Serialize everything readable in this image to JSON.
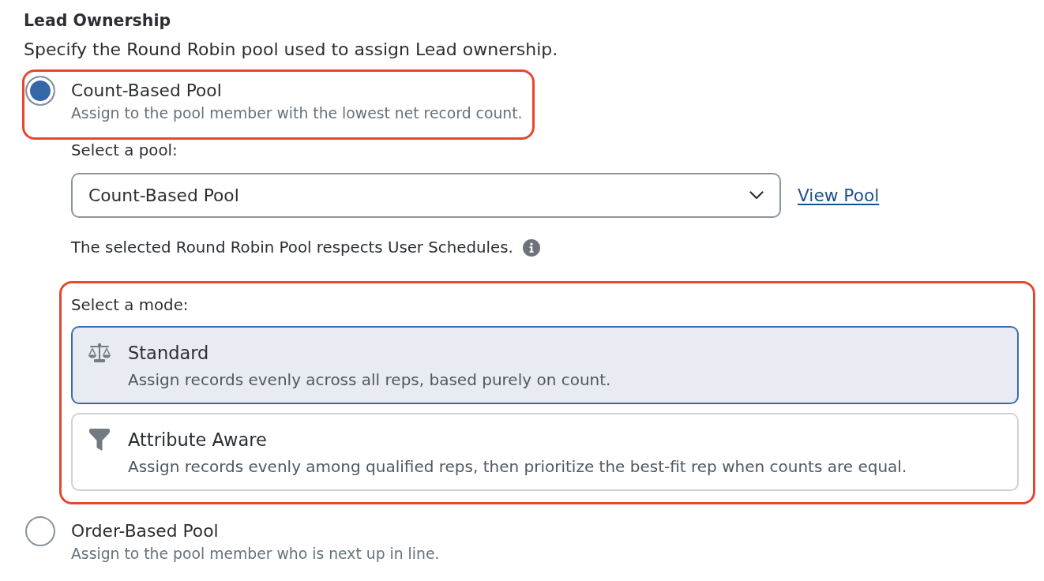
{
  "section": {
    "title": "Lead Ownership",
    "description": "Specify the Round Robin pool used to assign Lead ownership."
  },
  "pool_options": [
    {
      "label": "Count-Based Pool",
      "description": "Assign to the pool member with the lowest net record count.",
      "selected": true,
      "highlighted": true,
      "pool_picker": {
        "label": "Select a pool:",
        "value": "Count-Based Pool",
        "link": "View Pool"
      },
      "note": "The selected Round Robin Pool respects User Schedules.",
      "modes": {
        "label": "Select a mode:",
        "highlighted": true,
        "options": [
          {
            "title": "Standard",
            "description": "Assign records evenly across all reps, based purely on count.",
            "selected": true
          },
          {
            "title": "Attribute Aware",
            "description": "Assign records evenly among qualified reps, then prioritize the best-fit rep when counts are equal.",
            "selected": false
          }
        ]
      }
    },
    {
      "label": "Order-Based Pool",
      "description": "Assign to the pool member who is next up in line.",
      "selected": false,
      "highlighted": false
    }
  ]
}
